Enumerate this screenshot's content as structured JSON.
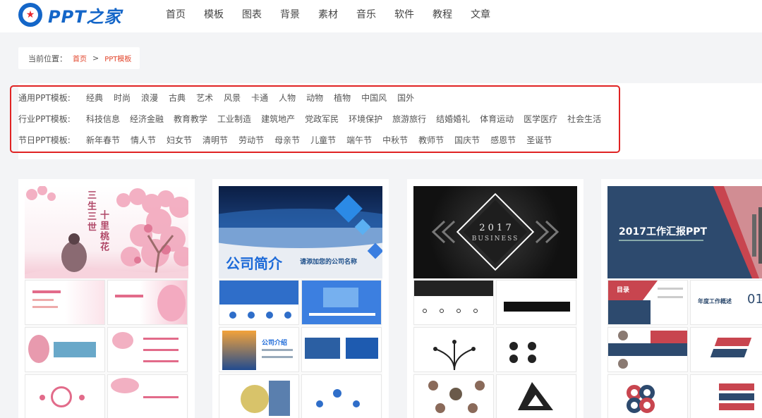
{
  "header": {
    "logo_text": "PPT之家",
    "nav": [
      "首页",
      "模板",
      "图表",
      "背景",
      "素材",
      "音乐",
      "软件",
      "教程",
      "文章"
    ]
  },
  "breadcrumb": {
    "label": "当前位置：",
    "items": [
      "首页",
      "PPT模板"
    ],
    "separator": ">"
  },
  "filters": [
    {
      "label": "通用PPT模板:",
      "tags": [
        "经典",
        "时尚",
        "浪漫",
        "古典",
        "艺术",
        "风景",
        "卡通",
        "人物",
        "动物",
        "植物",
        "中国风",
        "国外"
      ]
    },
    {
      "label": "行业PPT模板:",
      "tags": [
        "科技信息",
        "经济金融",
        "教育教学",
        "工业制造",
        "建筑地产",
        "党政军民",
        "环境保护",
        "旅游旅行",
        "结婚婚礼",
        "体育运动",
        "医学医疗",
        "社会生活"
      ]
    },
    {
      "label": "节日PPT模板:",
      "tags": [
        "新年春节",
        "情人节",
        "妇女节",
        "清明节",
        "劳动节",
        "母亲节",
        "儿童节",
        "端午节",
        "中秋节",
        "教师节",
        "国庆节",
        "感恩节",
        "圣诞节"
      ]
    }
  ],
  "cards": [
    {
      "title_a": "三生三世",
      "title_b": "十里桃花"
    },
    {
      "title": "公司简介",
      "subtitle": "请添加您的公司名称",
      "slide_title": "公司介绍"
    },
    {
      "year": "2 0 1 7",
      "title": "BUSINESS"
    },
    {
      "title": "2017工作汇报PPT",
      "menu": "目录",
      "slide_title": "年度工作概述",
      "number": "01"
    }
  ],
  "colors": {
    "brand": "#1466c8",
    "highlight_border": "#e02323",
    "breadcrumb_link": "#e2442b",
    "pink": "#e26b8a",
    "navy": "#2d4a6e",
    "red": "#c8454f"
  }
}
